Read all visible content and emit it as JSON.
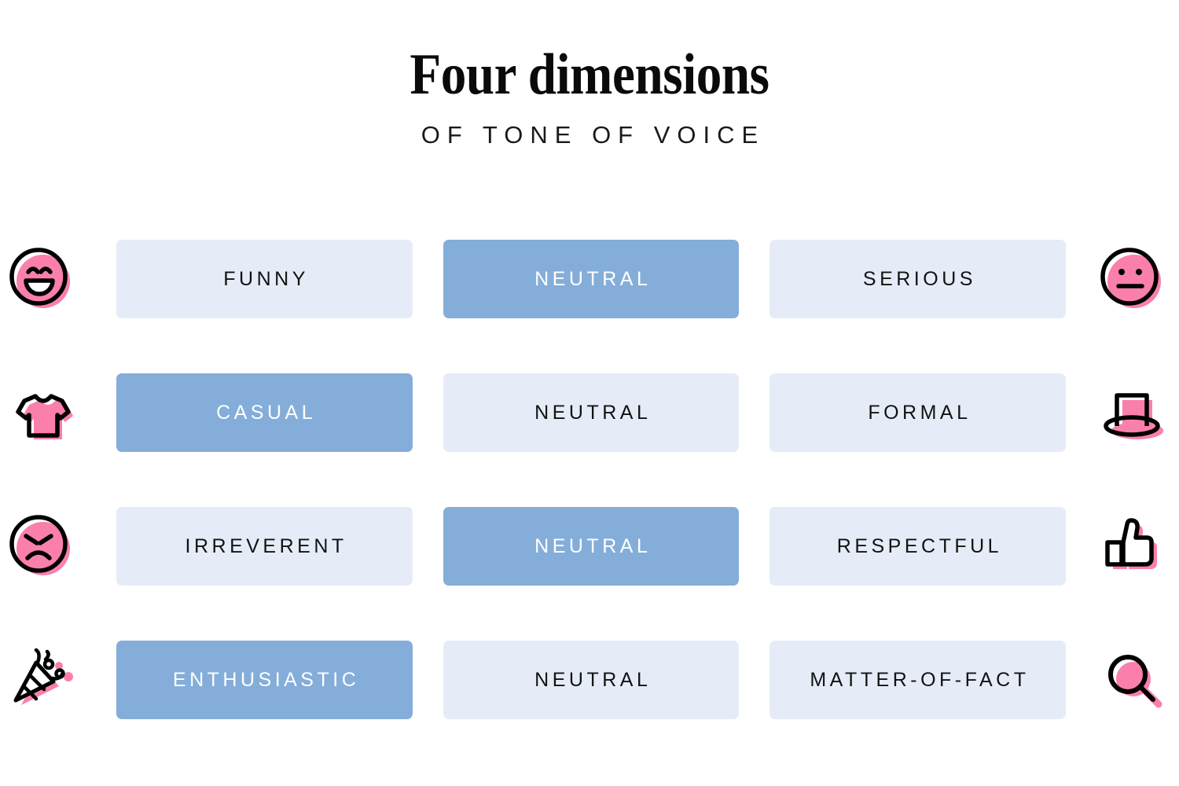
{
  "header": {
    "title": "Four dimensions",
    "subtitle": "OF TONE OF VOICE"
  },
  "colors": {
    "selected_bg": "#84aed9",
    "selected_text": "#ffffff",
    "cell_bg": "#e6ecf7",
    "cell_text": "#121212",
    "icon_accent": "#fa7fac",
    "icon_outline": "#000000",
    "page_bg": "#ffffff"
  },
  "grid": {
    "rows": [
      {
        "left_icon": "laughing-face-icon",
        "right_icon": "neutral-face-icon",
        "cells": [
          {
            "label": "FUNNY",
            "selected": false
          },
          {
            "label": "NEUTRAL",
            "selected": true
          },
          {
            "label": "SERIOUS",
            "selected": false
          }
        ]
      },
      {
        "left_icon": "t-shirt-icon",
        "right_icon": "top-hat-icon",
        "cells": [
          {
            "label": "CASUAL",
            "selected": true
          },
          {
            "label": "NEUTRAL",
            "selected": false
          },
          {
            "label": "FORMAL",
            "selected": false
          }
        ]
      },
      {
        "left_icon": "angry-face-icon",
        "right_icon": "thumbs-up-icon",
        "cells": [
          {
            "label": "IRREVERENT",
            "selected": false
          },
          {
            "label": "NEUTRAL",
            "selected": true
          },
          {
            "label": "RESPECTFUL",
            "selected": false
          }
        ]
      },
      {
        "left_icon": "party-popper-icon",
        "right_icon": "magnifying-glass-icon",
        "cells": [
          {
            "label": "ENTHUSIASTIC",
            "selected": true
          },
          {
            "label": "NEUTRAL",
            "selected": false
          },
          {
            "label": "MATTER-OF-FACT",
            "selected": false
          }
        ]
      }
    ]
  }
}
